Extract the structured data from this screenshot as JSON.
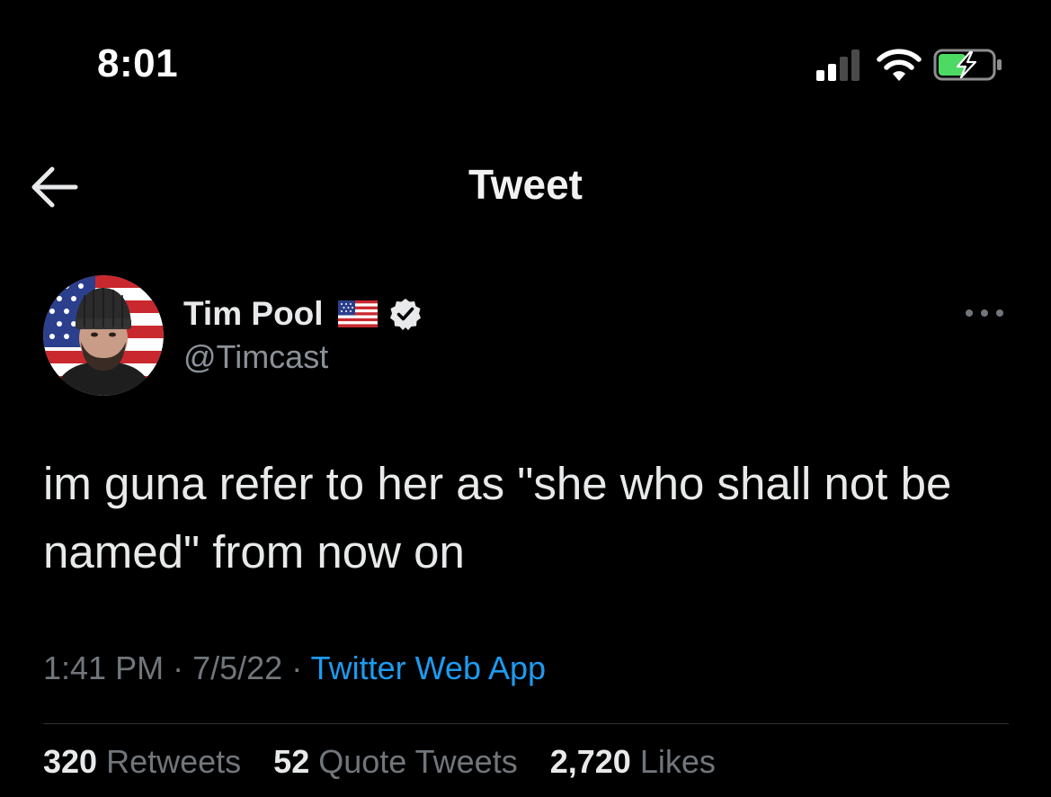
{
  "status_bar": {
    "time": "8:01",
    "icons": [
      "signal-icon",
      "wifi-icon",
      "battery-charging-icon"
    ]
  },
  "header": {
    "title": "Tweet",
    "back_icon": "arrow-left-icon"
  },
  "tweet": {
    "author": {
      "name": "Tim Pool",
      "handle": "@Timcast",
      "flag_icon": "us-flag-icon",
      "verified_icon": "verified-badge-icon"
    },
    "more_icon": "more-horizontal-icon",
    "text": "im guna refer to her as \"she who shall not be named\" from now on",
    "time": "1:41 PM",
    "date": "7/5/22",
    "separator": "·",
    "source": "Twitter Web App",
    "stats": [
      {
        "count": "320",
        "label": "Retweets"
      },
      {
        "count": "52",
        "label": "Quote Tweets"
      },
      {
        "count": "2,720",
        "label": "Likes"
      }
    ]
  },
  "colors": {
    "background": "#000000",
    "text": "#e7e9ea",
    "secondary_text": "#71767b",
    "link": "#1d9bf0",
    "battery_fill": "#4cd964",
    "divider": "#2f3336"
  }
}
